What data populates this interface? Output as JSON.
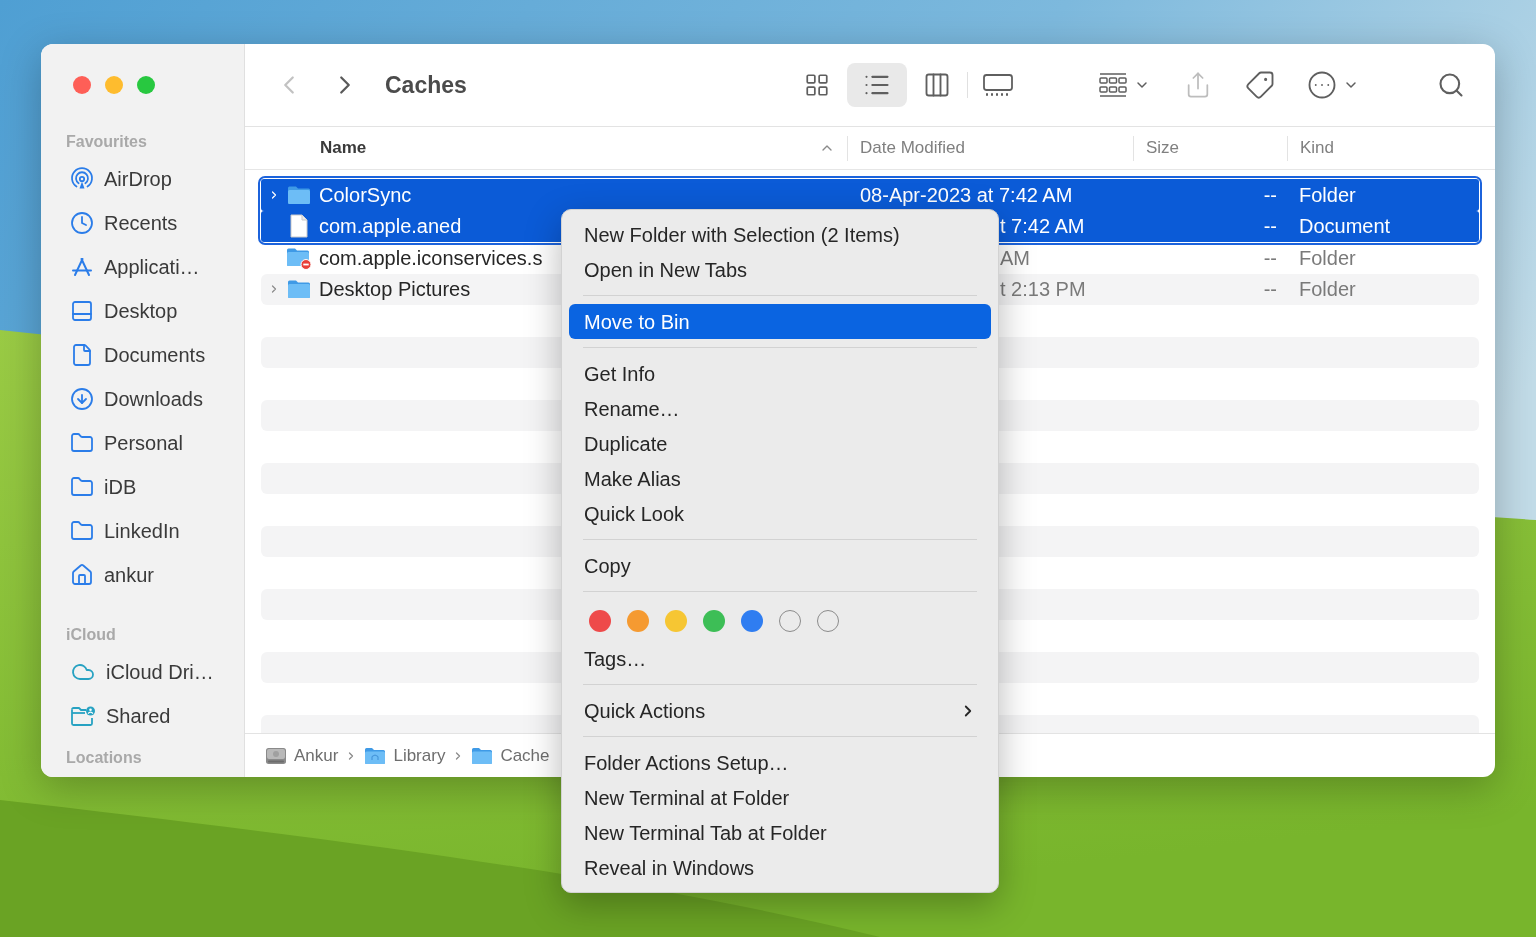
{
  "toolbar": {
    "back": {
      "disabled": true
    },
    "forward": {
      "disabled": false
    },
    "title": "Caches",
    "view_modes": [
      {
        "kind": "icons",
        "selected": false
      },
      {
        "kind": "list",
        "selected": true
      },
      {
        "kind": "columns",
        "selected": false
      },
      {
        "kind": "gallery",
        "selected": false
      }
    ],
    "share": {
      "disabled": true
    }
  },
  "sidebar": {
    "sections": [
      {
        "title": "Favourites",
        "items": [
          {
            "label": "AirDrop",
            "kind": "airdrop",
            "selected": false
          },
          {
            "label": "Recents",
            "kind": "recents",
            "selected": false
          },
          {
            "label": "Applicati…",
            "kind": "applications",
            "selected": false
          },
          {
            "label": "Desktop",
            "kind": "desktop",
            "selected": false
          },
          {
            "label": "Documents",
            "kind": "documents",
            "selected": false
          },
          {
            "label": "Downloads",
            "kind": "downloads",
            "selected": false
          },
          {
            "label": "Personal",
            "kind": "folder",
            "selected": false
          },
          {
            "label": "iDB",
            "kind": "folder",
            "selected": false
          },
          {
            "label": "LinkedIn",
            "kind": "folder",
            "selected": false
          },
          {
            "label": "ankur",
            "kind": "home",
            "selected": false
          }
        ]
      },
      {
        "title": "iCloud",
        "items": [
          {
            "label": "iCloud Dri…",
            "kind": "cloud",
            "selected": false
          },
          {
            "label": "Shared",
            "kind": "shared",
            "selected": false
          }
        ]
      },
      {
        "title": "Locations"
      }
    ]
  },
  "table": {
    "columns": [
      {
        "label": "Name",
        "sorted": true
      },
      {
        "label": "Date Modified",
        "sorted": false
      },
      {
        "label": "Size",
        "sorted": false
      },
      {
        "label": "Kind",
        "sorted": false
      }
    ],
    "rows": [
      {
        "name": "ColorSync",
        "date_modified": "08-Apr-2023 at 7:42 AM",
        "size": "--",
        "file_kind": "Folder",
        "kind": "folder",
        "expandable": true,
        "selected": true
      },
      {
        "name": "com.apple.aned",
        "date_modified": "t 7:42 AM",
        "size": "--",
        "file_kind": "Document",
        "kind": "document",
        "expandable": false,
        "selected": true
      },
      {
        "name": "com.apple.iconservices.s",
        "date_modified": "AM",
        "size": "--",
        "file_kind": "Folder",
        "kind": "restricted-folder",
        "expandable": false,
        "selected": false
      },
      {
        "name": "Desktop Pictures",
        "date_modified": "t 2:13 PM",
        "size": "--",
        "file_kind": "Folder",
        "kind": "folder",
        "expandable": true,
        "selected": false
      }
    ]
  },
  "path_bar": [
    {
      "label": "Ankur",
      "kind": "disk"
    },
    {
      "label": "Library",
      "kind": "library-folder"
    },
    {
      "label": "Cache",
      "kind": "folder"
    }
  ],
  "context_menu": {
    "items": [
      {
        "kind": "item",
        "label": "New Folder with Selection (2 Items)",
        "selected": false
      },
      {
        "kind": "item",
        "label": "Open in New Tabs",
        "selected": false
      },
      {
        "kind": "separator"
      },
      {
        "kind": "item",
        "label": "Move to Bin",
        "selected": true
      },
      {
        "kind": "separator"
      },
      {
        "kind": "item",
        "label": "Get Info",
        "selected": false
      },
      {
        "kind": "item",
        "label": "Rename…",
        "selected": false
      },
      {
        "kind": "item",
        "label": "Duplicate",
        "selected": false
      },
      {
        "kind": "item",
        "label": "Make Alias",
        "selected": false
      },
      {
        "kind": "item",
        "label": "Quick Look",
        "selected": false
      },
      {
        "kind": "separator"
      },
      {
        "kind": "item",
        "label": "Copy",
        "selected": false
      },
      {
        "kind": "separator"
      },
      {
        "kind": "tags",
        "tags": [
          {
            "kind": "color",
            "color": "#ee4a4a"
          },
          {
            "kind": "color",
            "color": "#f59a31"
          },
          {
            "kind": "color",
            "color": "#f6c633"
          },
          {
            "kind": "color",
            "color": "#3dbe56"
          },
          {
            "kind": "color",
            "color": "#2f7df1"
          },
          {
            "kind": "empty"
          },
          {
            "kind": "empty"
          }
        ]
      },
      {
        "kind": "item",
        "label": "Tags…",
        "selected": false
      },
      {
        "kind": "separator"
      },
      {
        "kind": "submenu",
        "label": "Quick Actions",
        "selected": false
      },
      {
        "kind": "separator"
      },
      {
        "kind": "item",
        "label": "Folder Actions Setup…",
        "selected": false
      },
      {
        "kind": "item",
        "label": "New Terminal at Folder",
        "selected": false
      },
      {
        "kind": "item",
        "label": "New Terminal Tab at Folder",
        "selected": false
      },
      {
        "kind": "item",
        "label": "Reveal in Windows",
        "selected": false
      }
    ]
  }
}
